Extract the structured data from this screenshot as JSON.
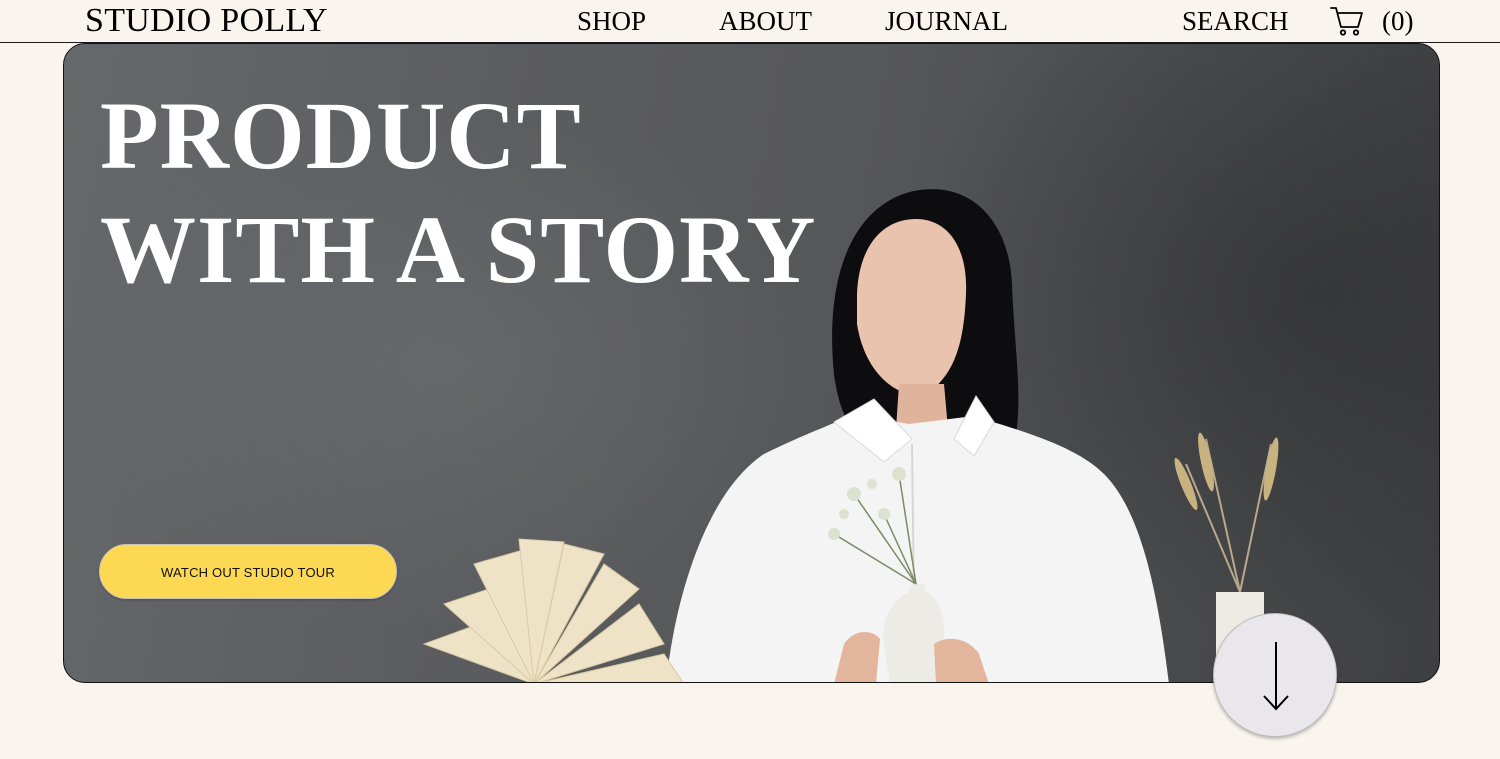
{
  "header": {
    "logo": "STUDIO POLLY",
    "nav": {
      "shop": "SHOP",
      "about": "ABOUT",
      "journal": "JOURNAL",
      "search": "SEARCH"
    },
    "cart_icon": "cart-icon",
    "cart_count": "(0)"
  },
  "hero": {
    "title_line1": "PRODUCT",
    "title_line2": "WITH A STORY",
    "cta_label": "WATCH OUT STUDIO TOUR",
    "scroll_icon": "arrow-down-icon"
  },
  "colors": {
    "background": "#f9f5ee",
    "cta": "#fdd853",
    "hero_text": "#ffffff",
    "scroll_button": "#e9e7ec"
  }
}
